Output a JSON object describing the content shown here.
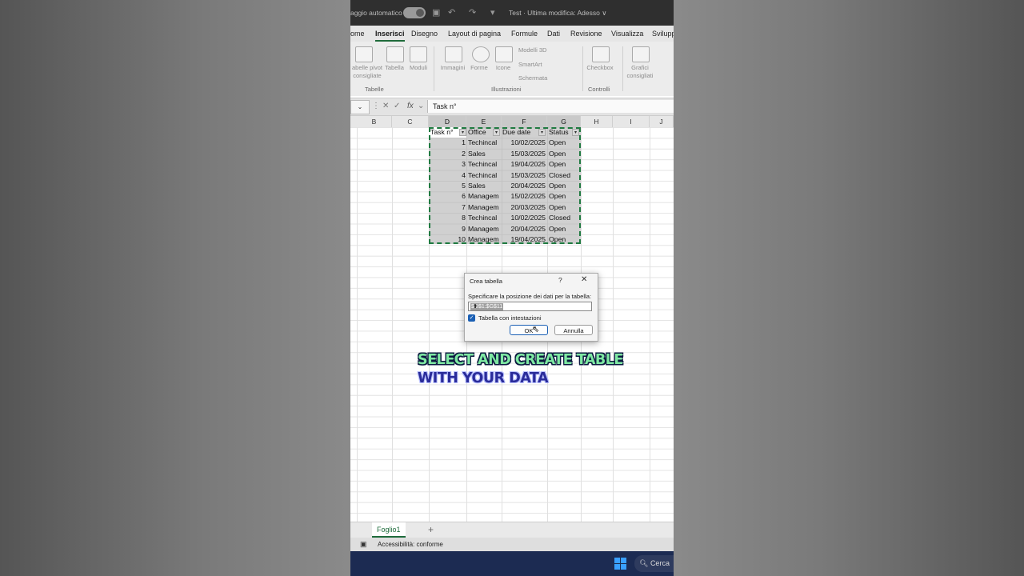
{
  "titlebar": {
    "autosave_label": "aggio automatico",
    "doc_title": "Test · Ultima modifica: Adesso ∨"
  },
  "tabs": [
    "ome",
    "Inserisci",
    "Disegno",
    "Layout di pagina",
    "Formule",
    "Dati",
    "Revisione",
    "Visualizza",
    "Svilupp"
  ],
  "ribbon": {
    "pivot": "abelle pivot\nconsigliate",
    "table": "Tabella",
    "forms": "Moduli",
    "images": "Immagini",
    "shapes": "Forme",
    "icons": "Icone",
    "models3d": "Modelli 3D",
    "smartart": "SmartArt",
    "screenshot": "Schermata",
    "checkbox": "Checkbox",
    "charts": "Grafici\nconsigliati",
    "group_tables": "Tabelle",
    "group_illustrations": "Illustrazioni",
    "group_controls": "Controlli"
  },
  "formula_bar": {
    "content": "Task n°"
  },
  "columns": [
    "B",
    "C",
    "D",
    "E",
    "F",
    "G",
    "H",
    "I",
    "J"
  ],
  "table": {
    "headers": [
      "Task n°",
      "Office",
      "Due date",
      "Status"
    ],
    "rows": [
      [
        "1",
        "Techincal",
        "10/02/2025",
        "Open"
      ],
      [
        "2",
        "Sales",
        "15/03/2025",
        "Open"
      ],
      [
        "3",
        "Techincal",
        "19/04/2025",
        "Open"
      ],
      [
        "4",
        "Techincal",
        "15/03/2025",
        "Closed"
      ],
      [
        "5",
        "Sales",
        "20/04/2025",
        "Open"
      ],
      [
        "6",
        "Managem",
        "15/02/2025",
        "Open"
      ],
      [
        "7",
        "Managem",
        "20/03/2025",
        "Open"
      ],
      [
        "8",
        "Techincal",
        "10/02/2025",
        "Closed"
      ],
      [
        "9",
        "Managem",
        "20/04/2025",
        "Open"
      ],
      [
        "10",
        "Managem",
        "19/04/2025",
        "Open"
      ]
    ]
  },
  "dialog": {
    "title": "Crea tabella",
    "help": "?",
    "prompt": "Specificare la posizione dei dati per la tabella:",
    "range": "$D$1:$G$11",
    "checkbox_label": "Tabella con intestazioni",
    "ok": "OK",
    "cancel": "Annulla"
  },
  "caption": {
    "line1": "SELECT AND CREATE TABLE",
    "line2": "WITH YOUR DATA"
  },
  "sheet_tab": "Foglio1",
  "status": {
    "accessibility": "Accessibilità: conforme"
  },
  "taskbar": {
    "search": "Cerca"
  }
}
